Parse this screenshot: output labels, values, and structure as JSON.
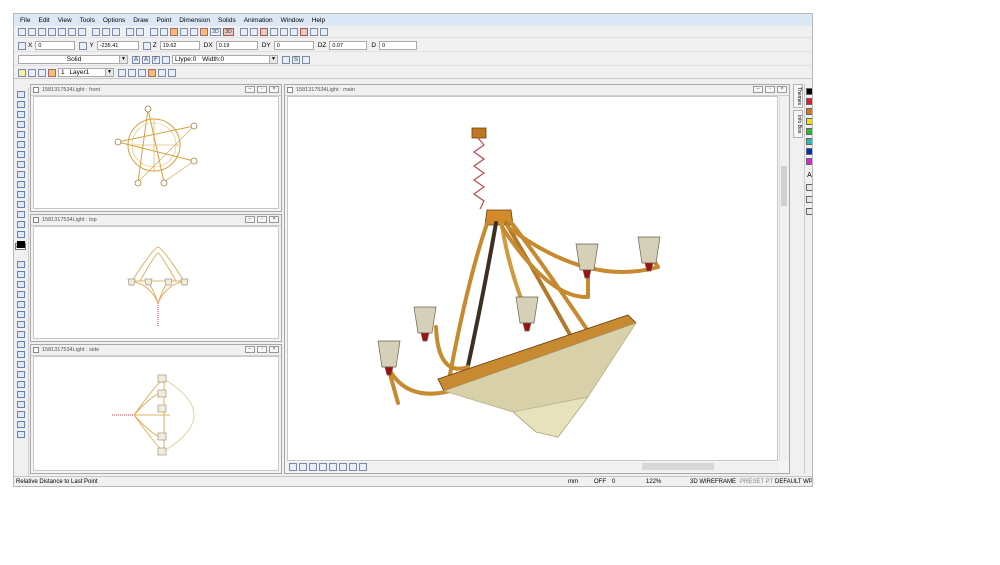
{
  "menu": [
    "File",
    "Edit",
    "View",
    "Tools",
    "Options",
    "Draw",
    "Point",
    "Dimension",
    "Solids",
    "Animation",
    "Window",
    "Help"
  ],
  "coords": {
    "x_label": "X",
    "x_value": "0",
    "y_label": "Y",
    "y_value": "-235.41",
    "z_label": "Z",
    "z_value": "19.62",
    "dx_label": "DX",
    "dx_value": "0.19",
    "dy_label": "DY",
    "dy_value": "0",
    "dz_label": "DZ",
    "dz_value": "0.07",
    "d_label": "D",
    "d_value": "0"
  },
  "style": {
    "fill": "Solid",
    "ltype": "Ltype:0",
    "width": "Width:0",
    "layer_num": "1",
    "layer_name": "Layer1",
    "btn_a": "A",
    "btn_a2": "A",
    "btn_f": "F",
    "btn_s": "S"
  },
  "windows": {
    "front_title": "1581317534Light : front",
    "top_title": "1581317534Light : top",
    "side_title": "1581317534Light : side",
    "main_title": "1581317534Light : main"
  },
  "tabs": [
    "Themes",
    "Info Box"
  ],
  "palette_colors": [
    "#000000",
    "#e02020",
    "#e07018",
    "#f0e000",
    "#20c020",
    "#20c0c0",
    "#0030c0",
    "#e020e0"
  ],
  "palette_extra": [
    "A"
  ],
  "status": {
    "hint": "Relative Distance to Last Point",
    "units": "mm",
    "snap": "OFF",
    "snap_val": "0",
    "zoom": "122%",
    "view_mode": "3D WIREFRAME",
    "preset": "PRESET PT",
    "workplane": "DEFAULT WP"
  },
  "toolbar_3d": "3D",
  "off_label": "OFF"
}
